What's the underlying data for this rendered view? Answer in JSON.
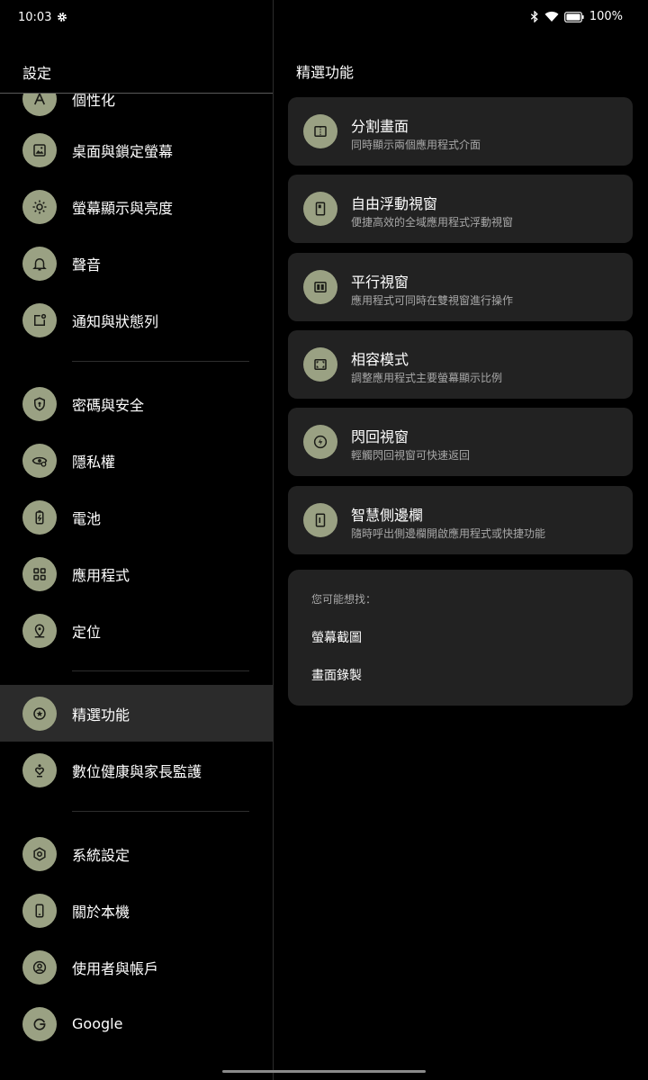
{
  "status_bar": {
    "time": "10:03",
    "battery": "100%"
  },
  "left": {
    "title": "設定",
    "items": [
      {
        "label": "個性化",
        "icon": "personalize-icon"
      },
      {
        "label": "桌面與鎖定螢幕",
        "icon": "wallpaper-icon"
      },
      {
        "label": "螢幕顯示與亮度",
        "icon": "brightness-icon"
      },
      {
        "label": "聲音",
        "icon": "bell-icon"
      },
      {
        "label": "通知與狀態列",
        "icon": "notification-icon"
      },
      {
        "label": "密碼與安全",
        "icon": "shield-icon"
      },
      {
        "label": "隱私權",
        "icon": "eye-icon"
      },
      {
        "label": "電池",
        "icon": "battery-icon"
      },
      {
        "label": "應用程式",
        "icon": "apps-grid-icon"
      },
      {
        "label": "定位",
        "icon": "location-icon"
      },
      {
        "label": "精選功能",
        "icon": "star-icon",
        "active": true
      },
      {
        "label": "數位健康與家長監護",
        "icon": "wellbeing-icon"
      },
      {
        "label": "系統設定",
        "icon": "system-gear-icon"
      },
      {
        "label": "關於本機",
        "icon": "phone-icon"
      },
      {
        "label": "使用者與帳戶",
        "icon": "account-icon"
      },
      {
        "label": "Google",
        "icon": "google-icon"
      }
    ]
  },
  "right": {
    "title": "精選功能",
    "cards": [
      {
        "title": "分割畫面",
        "subtitle": "同時顯示兩個應用程式介面",
        "icon": "split-screen-icon"
      },
      {
        "title": "自由浮動視窗",
        "subtitle": "便捷高效的全域應用程式浮動視窗",
        "icon": "floating-window-icon"
      },
      {
        "title": "平行視窗",
        "subtitle": "應用程式可同時在雙視窗進行操作",
        "icon": "parallel-window-icon"
      },
      {
        "title": "相容模式",
        "subtitle": "調整應用程式主要螢幕顯示比例",
        "icon": "compat-mode-icon"
      },
      {
        "title": "閃回視窗",
        "subtitle": "輕觸閃回視窗可快速返回",
        "icon": "flashback-icon"
      },
      {
        "title": "智慧側邊欄",
        "subtitle": "隨時呼出側邊欄開啟應用程式或快捷功能",
        "icon": "sidebar-icon"
      }
    ],
    "suggestions": {
      "title": "您可能想找：",
      "links": [
        "螢幕截圖",
        "畫面錄製"
      ]
    }
  },
  "colors": {
    "icon_bg": "#9aa183",
    "card_bg": "#222222",
    "active_bg": "#2b2b2b",
    "icon_fg": "#1b1c17"
  }
}
